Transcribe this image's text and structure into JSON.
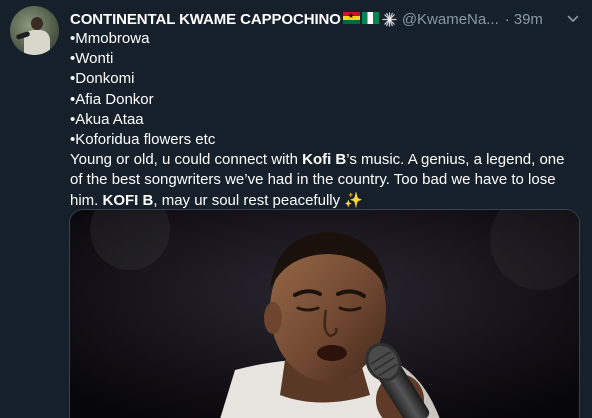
{
  "tweet": {
    "author_name": "CONTINENTAL KWAME CAPPOCHINO",
    "handle": "@KwameNa...",
    "separator": "·",
    "time": "39m",
    "list": [
      "•Mmobrowa",
      "•Wonti",
      "•Donkomi",
      "•Afia Donkor",
      "•Akua Ataa",
      "•Koforidua flowers etc"
    ],
    "para1_a": "Young or old, u could connect with ",
    "para1_b": "Kofi B",
    "para1_c": "’s music. A genius, a legend, one",
    "para2": "of the best songwriters we’ve had in the country. Too bad we have to lose",
    "para3_a": "him. ",
    "para3_b": "KOFI B",
    "para3_c": ", may ur soul rest peacefully ",
    "emoji_sparkles": "✨"
  },
  "icons": {
    "flag_1": "ghana-flag-icon",
    "flag_2": "nigeria-flag-icon",
    "sparkle": "sparkle-icon",
    "caret": "chevron-down-icon"
  },
  "colors": {
    "background": "#15202b",
    "primary_text": "#ffffff",
    "secondary_text": "#8899a6",
    "border": "#38444d"
  }
}
